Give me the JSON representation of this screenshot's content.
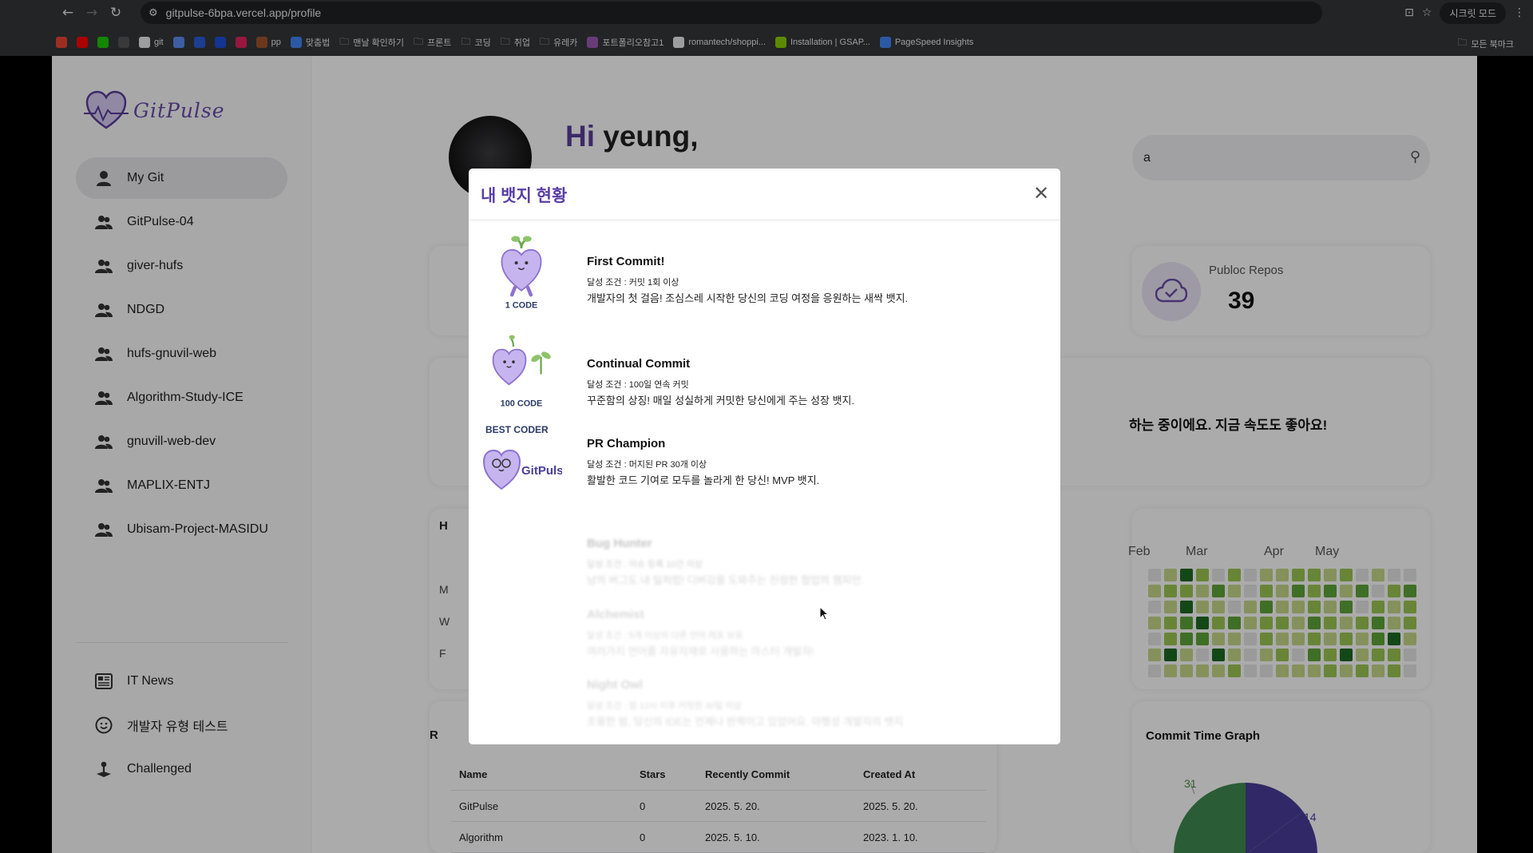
{
  "browser": {
    "url": "gitpulse-6bpa.vercel.app/profile",
    "incognito_label": "시크릿 모드",
    "bookmarks": [
      {
        "label": "",
        "color": "#ea4335"
      },
      {
        "label": "",
        "color": "#ff0000"
      },
      {
        "label": "",
        "color": "#1ec800"
      },
      {
        "label": "",
        "color": "#555555"
      },
      {
        "label": "git",
        "color": "#e8eaed"
      },
      {
        "label": "",
        "color": "#5b8def"
      },
      {
        "label": "",
        "color": "#2b5cd8"
      },
      {
        "label": "",
        "color": "#1d4ed8"
      },
      {
        "label": "",
        "color": "#e0245e"
      },
      {
        "label": "pp",
        "color": "#a0522d"
      },
      {
        "label": "맞춤법",
        "color": "#4285f4"
      },
      {
        "label": "맨날 확인하기",
        "color": "folder"
      },
      {
        "label": "프론트",
        "color": "folder"
      },
      {
        "label": "코딩",
        "color": "folder"
      },
      {
        "label": "취업",
        "color": "folder"
      },
      {
        "label": "유레카",
        "color": "folder"
      },
      {
        "label": "포트폴리오참고1",
        "color": "#9b59b6"
      },
      {
        "label": "romantech/shoppi...",
        "color": "#e8eaed"
      },
      {
        "label": "Installation | GSAP...",
        "color": "#88ce02"
      },
      {
        "label": "PageSpeed Insights",
        "color": "#4285f4"
      }
    ],
    "all_bookmarks": "모든 북마크"
  },
  "sidebar": {
    "logo_text": "GitPulse",
    "items": [
      {
        "label": "My Git",
        "icon": "user-icon",
        "active": true
      },
      {
        "label": "GitPulse-04",
        "icon": "users-icon"
      },
      {
        "label": "giver-hufs",
        "icon": "users-icon"
      },
      {
        "label": "NDGD",
        "icon": "users-icon"
      },
      {
        "label": "hufs-gnuvil-web",
        "icon": "users-icon"
      },
      {
        "label": "Algorithm-Study-ICE",
        "icon": "users-icon"
      },
      {
        "label": "gnuvill-web-dev",
        "icon": "users-icon"
      },
      {
        "label": "MAPLIX-ENTJ",
        "icon": "users-icon"
      },
      {
        "label": "Ubisam-Project-MASIDU",
        "icon": "users-icon"
      }
    ],
    "extra_items": [
      {
        "label": "IT News",
        "icon": "newspaper-icon"
      },
      {
        "label": "개발자 유형 테스트",
        "icon": "smile-icon"
      },
      {
        "label": "Challenged",
        "icon": "joystick-icon"
      }
    ]
  },
  "header": {
    "greeting_hi": "Hi",
    "greeting_name": "yeung,",
    "search_value": "a"
  },
  "stats": {
    "repos_label": "Publoc Repos",
    "repos_value": "39"
  },
  "status_message": "하는 중이에요. 지금 속도도 좋아요!",
  "left_letters": [
    "H",
    "M",
    "W",
    "F"
  ],
  "calendar": {
    "months": [
      "Feb",
      "Mar",
      "Apr",
      "May"
    ]
  },
  "pie_chart": {
    "title": "Commit Time Graph",
    "labels": [
      "31",
      "14"
    ],
    "colors": [
      "#3f8a4f",
      "#4a3e9a"
    ]
  },
  "repo_table": {
    "header_letter": "R",
    "columns": [
      "Name",
      "Stars",
      "Recently Commit",
      "Created At"
    ],
    "rows": [
      [
        "GitPulse",
        "0",
        "2025. 5. 20.",
        "2025. 5. 20."
      ],
      [
        "Algorithm",
        "0",
        "2025. 5. 10.",
        "2023. 1. 10."
      ]
    ]
  },
  "modal": {
    "title": "내 뱃지 현황",
    "badges": [
      {
        "name": "First Commit!",
        "condition": "달성 조건 : 커밋 1회 이상",
        "description": "개발자의 첫 걸음! 조심스레 시작한 당신의 코딩 여정을 응원하는 새싹 뱃지.",
        "image_caption": "1 CODE",
        "locked": false
      },
      {
        "name": "Continual Commit",
        "condition": "달성 조건 : 100일 연속 커밋",
        "description": "꾸준함의 상징! 매일 성실하게 커밋한 당신에게 주는 성장 뱃지.",
        "image_caption": "100 CODE",
        "locked": false
      },
      {
        "name": "PR Champion",
        "condition": "달성 조건 : 머지된 PR 30개 이상",
        "description": "활발한 코드 기여로 모두를 놀라게 한 당신! MVP 뱃지.",
        "image_caption": "BEST CODER",
        "image_caption2": "GitPulse",
        "locked": false
      },
      {
        "name": "Bug Hunter",
        "condition": "달성 조건 : 이슈 등록 10건 이상",
        "description": "남의 버그도 내 일처럼! 디버깅을 도와주는 진정한 협업의 챔피언.",
        "locked": true
      },
      {
        "name": "Alchemist",
        "condition": "달성 조건 : 5개 이상의 다른 언어 레포 보유",
        "description": "여러가지 언어를 자유자재로 사용하는 마스터 개발자!",
        "locked": true
      },
      {
        "name": "Night Owl",
        "condition": "달성 조건 : 밤 12시 이후 커밋한 30일 이상",
        "description": "조용한 밤, 당신의 IDE는 언제나 반짝이고 있었어요. 야행성 개발자의 뱃지",
        "locked": true
      }
    ]
  },
  "colors": {
    "accent": "#5a3ea6",
    "badge_purple": "#b9a6e6",
    "heat_levels": [
      "#e6e6e6",
      "#c5d98a",
      "#9bc653",
      "#5ea63a",
      "#1f6b25"
    ]
  }
}
